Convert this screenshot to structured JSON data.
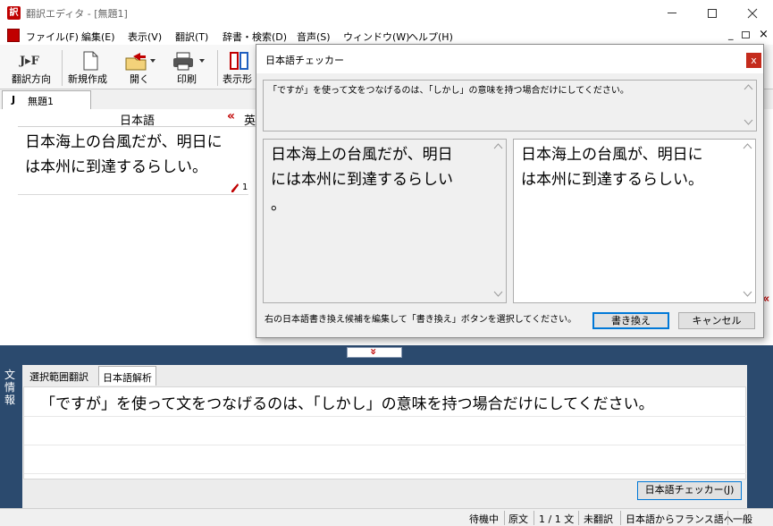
{
  "app": {
    "title": "翻訳エディタ - [無題1]",
    "window_controls": {
      "minimize": "─",
      "maximize": "☐",
      "close": "✕"
    },
    "mdi_controls": {
      "minimize": "_",
      "restore": "ı̲",
      "close": "×"
    }
  },
  "menu": [
    "ファイル(F)",
    "編集(E)",
    "表示(V)",
    "翻訳(T)",
    "辞書・検索(D)",
    "音声(S)",
    "ウィンドウ(W)",
    "ヘルプ(H)"
  ],
  "toolbar": {
    "direction_icon_text": "J▸F",
    "direction_label": "翻訳方向",
    "new_label": "新規作成",
    "open_label": "開く",
    "print_label": "印刷",
    "view_label": "表示形"
  },
  "doc_tab": {
    "prefix": "J",
    "name": "無題1"
  },
  "editor": {
    "source_header": "日本語",
    "collapse_marker": "«",
    "target_header_partial": "英",
    "source_text_line1": "日本海上の台風だが、明日に",
    "source_text_line2": "は本州に到達するらしい。",
    "sentence_number": "1",
    "right_marker": "«"
  },
  "splitter": {
    "handle_glyph": "»"
  },
  "info_panel": {
    "side_label": "文情報",
    "tabs": [
      "選択範囲翻訳",
      "日本語解析"
    ],
    "active_tab_index": 1,
    "message": "「ですが」を使って文をつなげるのは、「しかし」の意味を持つ場合だけにしてください。",
    "checker_button": "日本語チェッカー(J)"
  },
  "status": {
    "state": "待機中",
    "unit": "原文",
    "position": "1 / 1 文",
    "translation_status": "未翻訳",
    "direction": "日本語からフランス語へ",
    "category": "一般"
  },
  "dialog": {
    "title": "日本語チェッカー",
    "close": "x",
    "message": "「ですが」を使って文をつなげるのは、「しかし」の意味を持つ場合だけにしてください。",
    "original_text": "日本海上の台風だが、明日には本州に到達するらしい。",
    "original_lines": [
      "日本海上の台風だが、明日",
      "には本州に到達するらしい",
      "。"
    ],
    "suggested_text": "日本海上の台風が、明日には本州に到達するらしい。",
    "suggested_lines": [
      "日本海上の台風が、明日に",
      "は本州に到達するらしい。"
    ],
    "instruction": "右の日本語書き換え候補を編集して「書き換え」ボタンを選択してください。",
    "rewrite_button": "書き換え",
    "cancel_button": "キャンセル"
  },
  "colors": {
    "navy_panel": "#2b4a6e",
    "close_red": "#c42b1c",
    "marker_red": "#c00000",
    "focus_blue": "#0078d7"
  }
}
